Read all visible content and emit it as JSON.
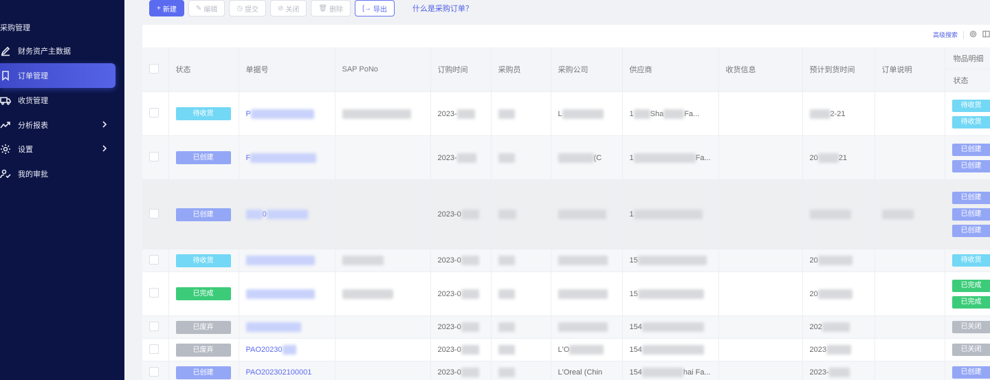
{
  "sidebar": {
    "section_title": "采购管理",
    "items": [
      {
        "label": "财务资产主数据",
        "icon": "edit-icon",
        "active": false,
        "chevron": false
      },
      {
        "label": "订单管理",
        "icon": "bookmark-icon",
        "active": true,
        "chevron": false
      },
      {
        "label": "收货管理",
        "icon": "truck-icon",
        "active": false,
        "chevron": false
      },
      {
        "label": "分析报表",
        "icon": "trend-chart-icon",
        "active": false,
        "chevron": true
      },
      {
        "label": "设置",
        "icon": "gear-icon",
        "active": false,
        "chevron": true
      },
      {
        "label": "我的审批",
        "icon": "user-check-icon",
        "active": false,
        "chevron": false
      }
    ]
  },
  "toolbar": {
    "new_label": "新建",
    "edit_label": "编辑",
    "submit_label": "提交",
    "close_label": "关闭",
    "delete_label": "删除",
    "export_label": "导出",
    "help_link": "什么是采购订单？"
  },
  "panel": {
    "advanced_search_label": "高级搜索"
  },
  "table": {
    "group_header": "物品明细",
    "columns": {
      "status": "状态",
      "doc_no": "单据号",
      "sap_po": "SAP PoNo",
      "order_time": "订购时间",
      "buyer": "采购员",
      "company": "采购公司",
      "supplier": "供应商",
      "receipt": "收货信息",
      "eta": "预计到货时间",
      "remark": "订单说明",
      "item_status": "状态"
    },
    "rows": [
      {
        "status": "待收货",
        "status_color": "cyan",
        "doc": "P",
        "order": "2023-",
        "company": "L",
        "supplier": "1",
        "supplier_suffix": "Sha",
        "supplier_end": "Fa...",
        "eta": "2-21",
        "items": [
          {
            "label": "待收货",
            "color": "cyan"
          },
          {
            "label": "待收货",
            "color": "cyan"
          }
        ]
      },
      {
        "status": "已创建",
        "status_color": "blue",
        "doc": "F",
        "order": "2023-",
        "company": "(C",
        "supplier": "1",
        "supplier_end": "Fa...",
        "eta": "21",
        "eta_prefix": "20",
        "items": [
          {
            "label": "已创建",
            "color": "blue"
          },
          {
            "label": "已创建",
            "color": "blue"
          }
        ]
      },
      {
        "status": "已创建",
        "status_color": "blue",
        "doc": "0",
        "order": "2023-0",
        "company": "",
        "supplier": "1",
        "eta": "",
        "items": [
          {
            "label": "已创建",
            "color": "blue"
          },
          {
            "label": "已创建",
            "color": "blue"
          },
          {
            "label": "已创建",
            "color": "blue"
          }
        ]
      },
      {
        "status": "待收货",
        "status_color": "cyan",
        "doc": "",
        "order": "2023-0",
        "company": "",
        "supplier": "15",
        "eta": "",
        "eta_prefix": "20",
        "items": [
          {
            "label": "待收货",
            "color": "cyan"
          }
        ]
      },
      {
        "status": "已完成",
        "status_color": "green",
        "doc": "",
        "order": "2023-0",
        "company": "",
        "supplier": "15",
        "eta": "",
        "eta_prefix": "20",
        "items": [
          {
            "label": "已完成",
            "color": "green"
          },
          {
            "label": "已完成",
            "color": "green"
          }
        ]
      },
      {
        "status": "已废弃",
        "status_color": "grey",
        "doc": "",
        "order": "2023-0",
        "company": "",
        "supplier": "154",
        "eta": "",
        "eta_prefix": "202",
        "items": [
          {
            "label": "已关闭",
            "color": "grey"
          }
        ]
      },
      {
        "status": "已废弃",
        "status_color": "grey",
        "doc": "PAO20230",
        "order": "2023-0",
        "company": "L'O",
        "supplier": "154",
        "eta": "",
        "eta_prefix": "2023",
        "items": [
          {
            "label": "已关闭",
            "color": "grey"
          }
        ]
      },
      {
        "status": "已创建",
        "status_color": "blue",
        "doc": "PAO202302100001",
        "order": "2023-0",
        "company": "L'Oreal (Chin",
        "supplier": "154",
        "supplier_end": "hai Fa...",
        "eta": "",
        "eta_prefix": "2023-",
        "items": [
          {
            "label": "已创建",
            "color": "blue"
          }
        ]
      }
    ]
  },
  "colors": {
    "sidebar_bg": "#0c1445",
    "accent": "#5b6bf0",
    "status_cyan": "#73d8f5",
    "status_blue": "#94a7f6",
    "status_green": "#3ccc79",
    "status_grey": "#b6bbc4"
  }
}
